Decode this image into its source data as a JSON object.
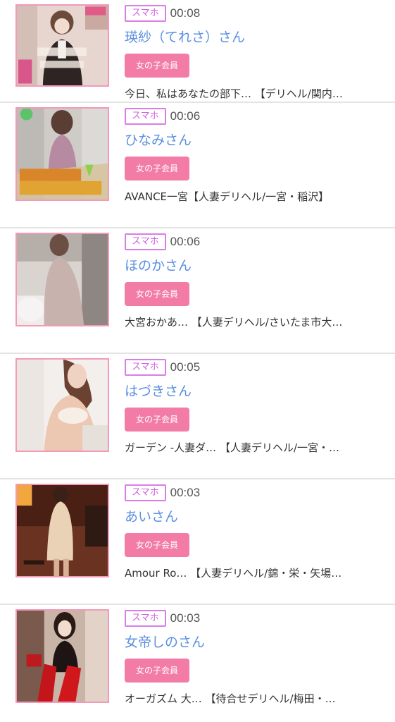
{
  "feed": {
    "items": [
      {
        "device": "スマホ",
        "time": "00:08",
        "name": "瑛紗（てれさ）さん",
        "member": "女の子会員",
        "shop": "今日、私はあなたの部下… 【デリヘル/関内…",
        "thumb_colors": [
          "#c9b8ae",
          "#3a2a2a",
          "#f2e4de"
        ]
      },
      {
        "device": "スマホ",
        "time": "00:06",
        "name": "ひなみさん",
        "member": "女の子会員",
        "shop": "AVANCE一宮【人妻デリヘル/一宮・稲沢】",
        "thumb_colors": [
          "#b9b4ae",
          "#a98ea0",
          "#e2e0de"
        ]
      },
      {
        "device": "スマホ",
        "time": "00:06",
        "name": "ほのかさん",
        "member": "女の子会員",
        "shop": "大宮おかあ… 【人妻デリヘル/さいたま市大…",
        "thumb_colors": [
          "#b8b0ac",
          "#c9b7b4",
          "#e9e4e4"
        ]
      },
      {
        "device": "スマホ",
        "time": "00:05",
        "name": "はづきさん",
        "member": "女の子会員",
        "shop": "ガーデン -人妻ダ… 【人妻デリヘル/一宮・…",
        "thumb_colors": [
          "#f2ece8",
          "#e9cfc0",
          "#d6a690"
        ]
      },
      {
        "device": "スマホ",
        "time": "00:03",
        "name": "あいさん",
        "member": "女の子会員",
        "shop": "Amour Ro… 【人妻デリヘル/錦・栄・矢場…",
        "thumb_colors": [
          "#4a2418",
          "#8a4a2a",
          "#e8d0b0"
        ]
      },
      {
        "device": "スマホ",
        "time": "00:03",
        "name": "女帝しのさん",
        "member": "女の子会員",
        "shop": "オーガズム 大… 【待合せデリヘル/梅田・…",
        "thumb_colors": [
          "#6a4a40",
          "#c21e1e",
          "#d8c0b0"
        ]
      }
    ]
  }
}
